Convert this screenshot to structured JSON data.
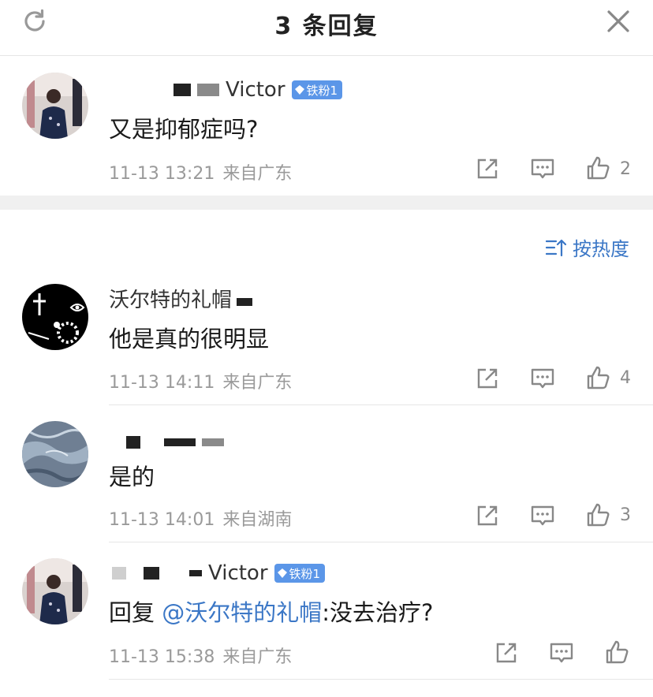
{
  "header": {
    "title": "3 条回复"
  },
  "root": {
    "name": "Victor",
    "badge": "铁粉1",
    "text": "又是抑郁症吗?",
    "time": "11-13 13:21",
    "location": "来自广东",
    "likes": "2"
  },
  "sort": {
    "label": "按热度"
  },
  "replies": [
    {
      "name": "沃尔特的礼帽",
      "text": "他是真的很明显",
      "time": "11-13 14:11",
      "location": "来自广东",
      "likes": "4"
    },
    {
      "name": "",
      "text": "是的",
      "time": "11-13 14:01",
      "location": "来自湖南",
      "likes": "3"
    },
    {
      "name": "Victor",
      "badge": "铁粉1",
      "text_prefix": "回复 ",
      "mention": "@沃尔特的礼帽",
      "text_suffix": ":没去治疗?",
      "time": "11-13 15:38",
      "location": "来自广东",
      "likes": ""
    }
  ],
  "colors": {
    "accent": "#3b77c6",
    "badge": "#5b96e8",
    "meta": "#9a9a9a"
  },
  "icons": [
    "refresh-icon",
    "close-icon",
    "share-icon",
    "comment-icon",
    "like-icon",
    "sort-icon"
  ]
}
